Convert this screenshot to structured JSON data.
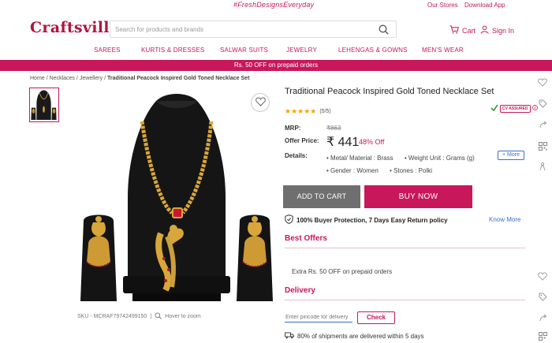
{
  "topbar": {
    "tagline": "#FreshDesignsEveryday",
    "our_stores": "Our Stores",
    "download_app": "Download App"
  },
  "header": {
    "logo": "Craftsvilla",
    "search_placeholder": "Search for products and brands",
    "cart_label": "Cart",
    "signin_label": "Sign In"
  },
  "nav": {
    "categories": [
      "SAREES",
      "KURTIS & DRESSES",
      "SALWAR SUITS",
      "JEWELRY",
      "LEHENGAS & GOWNS",
      "MEN'S WEAR"
    ]
  },
  "promo_banner": "Rs. 50 OFF on prepaid orders",
  "breadcrumb": {
    "items": [
      "Home",
      "Necklaces",
      "Jewellery"
    ],
    "separator": "/",
    "current": "Traditional Peacock Inspired Gold Toned Necklace Set"
  },
  "gallery": {
    "sku_text": "SKU - MCRAF79742499150",
    "divider": "|",
    "zoom_hint": "Hover to zoom"
  },
  "product": {
    "title": "Traditional Peacock Inspired Gold Toned Necklace Set",
    "rating": 5,
    "rating_text": "(5/5)",
    "assured_badge": "CV ASSURED",
    "mrp_label": "MRP:",
    "mrp_value": "₹863",
    "offer_label": "Offer Price:",
    "offer_value": "₹ 441",
    "discount": "48% Off",
    "details_label": "Details:",
    "details": [
      "Metal/ Material : Brass",
      "Weight Unit : Grams (g)",
      "Gender : Women",
      "Stones : Polki"
    ],
    "more_label": "+ More",
    "add_to_cart": "ADD TO CART",
    "buy_now": "BUY NOW",
    "protection_text": "100% Buyer Protection, 7 Days Easy Return policy",
    "know_more": "Know More"
  },
  "best_offers": {
    "title": "Best Offers",
    "offer": "Extra Rs. 50 OFF on prepaid orders"
  },
  "delivery": {
    "title": "Delivery",
    "pincode_placeholder": "Enter pincode for delivery",
    "check_label": "Check",
    "shipping_note": "80% of shipments are delivered within 5 days"
  },
  "colors": {
    "brand": "#c8175b",
    "logo": "#b3143f",
    "link": "#3a6fc7",
    "cart_button": "#6f6f6f",
    "star": "#f0a500"
  }
}
